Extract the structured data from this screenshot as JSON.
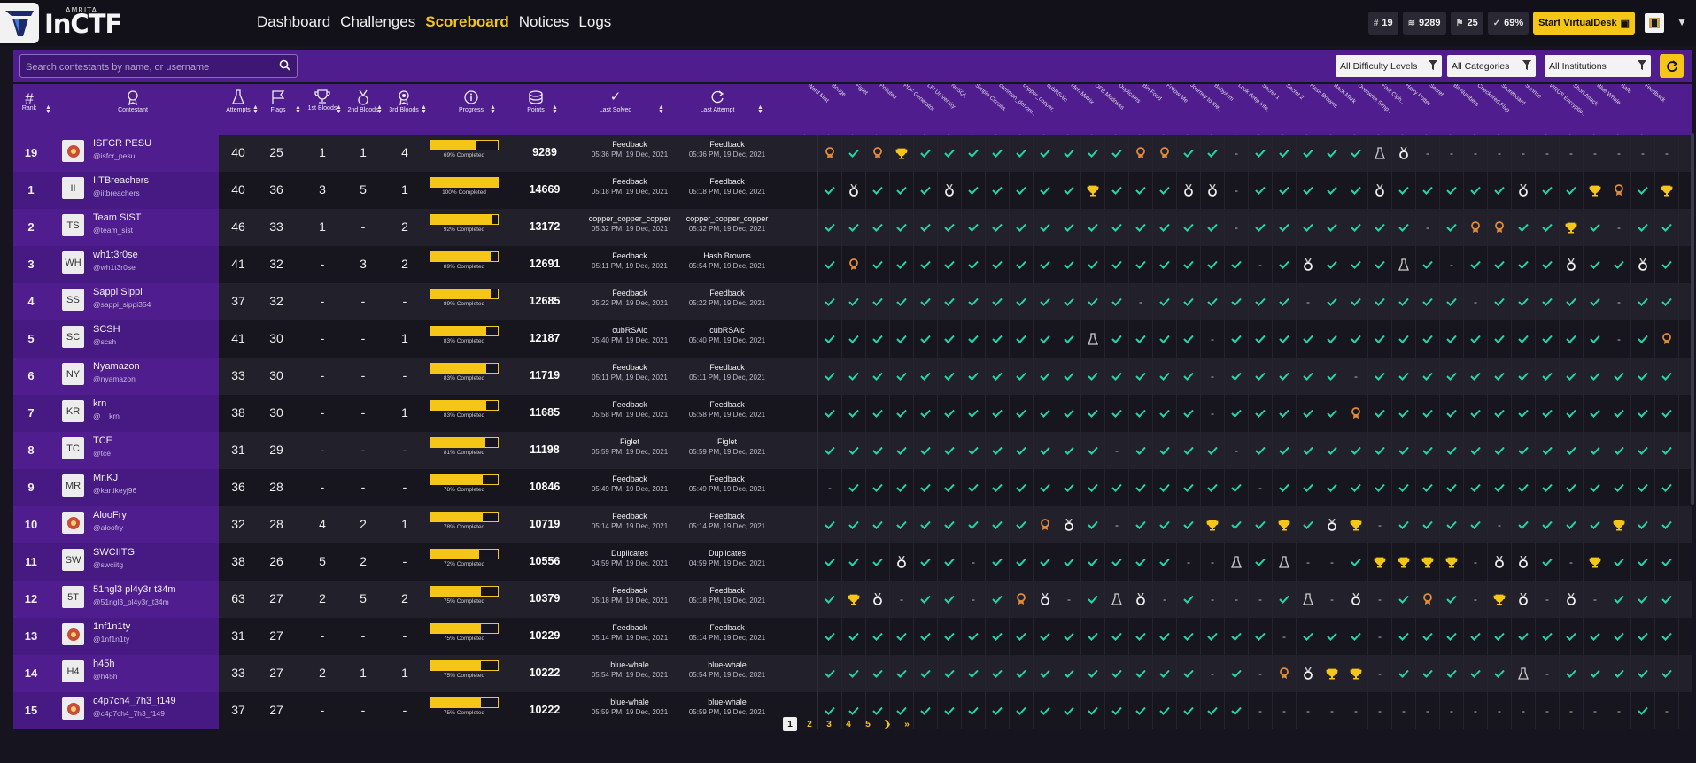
{
  "brand": {
    "small": "AMRITA",
    "big": "InCTF"
  },
  "nav": [
    "Dashboard",
    "Challenges",
    "Scoreboard",
    "Notices",
    "Logs"
  ],
  "nav_active": "Scoreboard",
  "stats": {
    "rank": "19",
    "points": "9289",
    "flags": "25",
    "progress": "69%",
    "start_label": "Start VirtualDesk"
  },
  "search": {
    "placeholder": "Search contestants by name, or username"
  },
  "filters": {
    "difficulty": "All Difficulty Levels",
    "categories": "All Categories",
    "institutions": "All Institutions"
  },
  "columns": {
    "rank": "Rank",
    "contestant": "Contestant",
    "attempts": "Attempts",
    "flags": "Flags",
    "first": "1st Bloods",
    "second": "2nd Bloods",
    "third": "3rd Bloods",
    "progress": "Progress",
    "points": "Points",
    "last_solved": "Last Solved",
    "last_attempt": "Last Attempt"
  },
  "challenges": [
    "Word Mist",
    "Bodge",
    "Figlet",
    "Polluted",
    "PDF Generator",
    "LFI University",
    "NoSQL",
    "Simple Circuits",
    "common_denom..",
    "copper_copper..",
    "cubRSAic",
    "Meh Matrix",
    "OFB Madness",
    "Duplicates",
    "Bin Food",
    "Follow Me",
    "Journey to the..",
    "BabyArm",
    "Look deep into..",
    "Secret 1",
    "Secret 2",
    "Hash Browns",
    "Back Mark",
    "Overwrite Simp..",
    "Fast Ciph..",
    "Harry Potter",
    "Secret",
    "Bit Numbers",
    "Checkered Flag",
    "Scoreboard",
    "Sunrise",
    "VIRUS Encryptio..",
    "Short Attack",
    "Blue Whale",
    "Safe",
    "Feedback"
  ],
  "rows": [
    {
      "rank": "19",
      "name": "ISFCR PESU",
      "user": "@isfcr_pesu",
      "initials": "",
      "attempts": "40",
      "flags": "25",
      "b1": "1",
      "b2": "1",
      "b3": "4",
      "progress": 69,
      "progress_label": "69% Completed",
      "points": "9289",
      "solved": "Feedback",
      "solved_t": "05:36 PM, 19 Dec, 2021",
      "attempt": "Feedback",
      "attempt_t": "05:36 PM, 19 Dec, 2021"
    },
    {
      "rank": "1",
      "name": "IITBreachers",
      "user": "@iitbreachers",
      "initials": "II",
      "attempts": "40",
      "flags": "36",
      "b1": "3",
      "b2": "5",
      "b3": "1",
      "progress": 100,
      "progress_label": "100% Completed",
      "points": "14669",
      "solved": "Feedback",
      "solved_t": "05:18 PM, 19 Dec, 2021",
      "attempt": "Feedback",
      "attempt_t": "05:18 PM, 19 Dec, 2021"
    },
    {
      "rank": "2",
      "name": "Team SIST",
      "user": "@team_sist",
      "initials": "TS",
      "attempts": "46",
      "flags": "33",
      "b1": "1",
      "b2": "-",
      "b3": "2",
      "progress": 92,
      "progress_label": "92% Completed",
      "points": "13172",
      "solved": "copper_copper_copper",
      "solved_t": "05:32 PM, 19 Dec, 2021",
      "attempt": "copper_copper_copper",
      "attempt_t": "05:32 PM, 19 Dec, 2021"
    },
    {
      "rank": "3",
      "name": "wh1t3r0se",
      "user": "@wh1t3r0se",
      "initials": "WH",
      "attempts": "41",
      "flags": "32",
      "b1": "-",
      "b2": "3",
      "b3": "2",
      "progress": 89,
      "progress_label": "89% Completed",
      "points": "12691",
      "solved": "Feedback",
      "solved_t": "05:11 PM, 19 Dec, 2021",
      "attempt": "Hash Browns",
      "attempt_t": "05:54 PM, 19 Dec, 2021"
    },
    {
      "rank": "4",
      "name": "Sappi Sippi",
      "user": "@sappi_sippi354",
      "initials": "SS",
      "attempts": "37",
      "flags": "32",
      "b1": "-",
      "b2": "-",
      "b3": "-",
      "progress": 89,
      "progress_label": "89% Completed",
      "points": "12685",
      "solved": "Feedback",
      "solved_t": "05:22 PM, 19 Dec, 2021",
      "attempt": "Feedback",
      "attempt_t": "05:22 PM, 19 Dec, 2021"
    },
    {
      "rank": "5",
      "name": "SCSH",
      "user": "@scsh",
      "initials": "SC",
      "attempts": "41",
      "flags": "30",
      "b1": "-",
      "b2": "-",
      "b3": "1",
      "progress": 83,
      "progress_label": "83% Completed",
      "points": "12187",
      "solved": "cubRSAic",
      "solved_t": "05:40 PM, 19 Dec, 2021",
      "attempt": "cubRSAic",
      "attempt_t": "05:40 PM, 19 Dec, 2021"
    },
    {
      "rank": "6",
      "name": "Nyamazon",
      "user": "@nyamazon",
      "initials": "NY",
      "attempts": "33",
      "flags": "30",
      "b1": "-",
      "b2": "-",
      "b3": "-",
      "progress": 83,
      "progress_label": "83% Completed",
      "points": "11719",
      "solved": "Feedback",
      "solved_t": "05:11 PM, 19 Dec, 2021",
      "attempt": "Feedback",
      "attempt_t": "05:11 PM, 19 Dec, 2021"
    },
    {
      "rank": "7",
      "name": "krn",
      "user": "@__krn",
      "initials": "KR",
      "attempts": "38",
      "flags": "30",
      "b1": "-",
      "b2": "-",
      "b3": "1",
      "progress": 83,
      "progress_label": "83% Completed",
      "points": "11685",
      "solved": "Feedback",
      "solved_t": "05:58 PM, 19 Dec, 2021",
      "attempt": "Feedback",
      "attempt_t": "05:58 PM, 19 Dec, 2021"
    },
    {
      "rank": "8",
      "name": "TCE",
      "user": "@tce",
      "initials": "TC",
      "attempts": "31",
      "flags": "29",
      "b1": "-",
      "b2": "-",
      "b3": "-",
      "progress": 81,
      "progress_label": "81% Completed",
      "points": "11198",
      "solved": "Figlet",
      "solved_t": "05:59 PM, 19 Dec, 2021",
      "attempt": "Figlet",
      "attempt_t": "05:59 PM, 19 Dec, 2021"
    },
    {
      "rank": "9",
      "name": "Mr.KJ",
      "user": "@kartikeyj96",
      "initials": "MR",
      "attempts": "36",
      "flags": "28",
      "b1": "-",
      "b2": "-",
      "b3": "-",
      "progress": 78,
      "progress_label": "78% Completed",
      "points": "10846",
      "solved": "Feedback",
      "solved_t": "05:49 PM, 19 Dec, 2021",
      "attempt": "Feedback",
      "attempt_t": "05:49 PM, 19 Dec, 2021"
    },
    {
      "rank": "10",
      "name": "AlooFry",
      "user": "@aloofry",
      "initials": "",
      "attempts": "32",
      "flags": "28",
      "b1": "4",
      "b2": "2",
      "b3": "1",
      "progress": 78,
      "progress_label": "78% Completed",
      "points": "10719",
      "solved": "Feedback",
      "solved_t": "05:14 PM, 19 Dec, 2021",
      "attempt": "Feedback",
      "attempt_t": "05:14 PM, 19 Dec, 2021"
    },
    {
      "rank": "11",
      "name": "SWCIITG",
      "user": "@swciitg",
      "initials": "SW",
      "attempts": "38",
      "flags": "26",
      "b1": "5",
      "b2": "2",
      "b3": "-",
      "progress": 72,
      "progress_label": "72% Completed",
      "points": "10556",
      "solved": "Duplicates",
      "solved_t": "04:59 PM, 19 Dec, 2021",
      "attempt": "Duplicates",
      "attempt_t": "04:59 PM, 19 Dec, 2021"
    },
    {
      "rank": "12",
      "name": "51ngl3 pl4y3r t34m",
      "user": "@51ngl3_pl4y3r_t34m",
      "initials": "5T",
      "attempts": "63",
      "flags": "27",
      "b1": "2",
      "b2": "5",
      "b3": "2",
      "progress": 75,
      "progress_label": "75% Completed",
      "points": "10379",
      "solved": "Feedback",
      "solved_t": "05:18 PM, 19 Dec, 2021",
      "attempt": "Feedback",
      "attempt_t": "05:18 PM, 19 Dec, 2021"
    },
    {
      "rank": "13",
      "name": "1nf1n1ty",
      "user": "@1nf1n1ty",
      "initials": "",
      "attempts": "31",
      "flags": "27",
      "b1": "-",
      "b2": "-",
      "b3": "-",
      "progress": 75,
      "progress_label": "75% Completed",
      "points": "10229",
      "solved": "Feedback",
      "solved_t": "05:14 PM, 19 Dec, 2021",
      "attempt": "Feedback",
      "attempt_t": "05:14 PM, 19 Dec, 2021"
    },
    {
      "rank": "14",
      "name": "h45h",
      "user": "@h45h",
      "initials": "H4",
      "attempts": "33",
      "flags": "27",
      "b1": "2",
      "b2": "1",
      "b3": "1",
      "progress": 75,
      "progress_label": "75% Completed",
      "points": "10222",
      "solved": "blue-whale",
      "solved_t": "05:54 PM, 19 Dec, 2021",
      "attempt": "blue-whale",
      "attempt_t": "05:54 PM, 19 Dec, 2021"
    },
    {
      "rank": "15",
      "name": "c4p7ch4_7h3_f149",
      "user": "@c4p7ch4_7h3_f149",
      "initials": "",
      "attempts": "37",
      "flags": "27",
      "b1": "-",
      "b2": "-",
      "b3": "-",
      "progress": 75,
      "progress_label": "75% Completed",
      "points": "10222",
      "solved": "blue-whale",
      "solved_t": "05:59 PM, 19 Dec, 2021",
      "attempt": "blue-whale",
      "attempt_t": "05:59 PM, 19 Dec, 2021"
    }
  ],
  "grid": [
    "bcbTcccccccccbbcc-ccccc1s-------------",
    "cscccscccccTcccss-cccccscccccsccTbcTccc",
    "ccccccccccccccccc-ccccccc-cbbccTc-cccc",
    "cbcccccccccccccccc-csccc1c-ccccsccsccb",
    "ccccccccccccc-cccccc-cccccc-ccccc-cccc",
    "ccccccccccc1cccc-cccccccccccccccc-cb-c",
    "cccccccccccccccc-ccccc-cccccccccccccc",
    "cccccccccccccccc-cccccbccccccccccccc",
    "cccccccccccc-cccc-cccccccccccccccccc",
    "-ccccccccccccccccc-ccccccccccccccccc",
    "cccccccccbsc-cccTccTcsT-cccc-ccccTc",
    "cccscc-cccccccc--1c1--cTTTT-ssc-Tcc",
    "cTs-cc-cbs-c1s-c---c1-s-cbc-Ts-s-ccc",
    "ccccccccccccccccccc-ccc-cccccccccccc",
    "cccccccccccccccc-c-bsTT-ccccc1-cccccc",
    "cccccccccccccccccc----------------c-c"
  ],
  "pages": [
    "1",
    "2",
    "3",
    "4",
    "5"
  ],
  "colors": {
    "accent": "#f5c518",
    "purple": "#4f1d8e",
    "check": "#22d6a6"
  }
}
